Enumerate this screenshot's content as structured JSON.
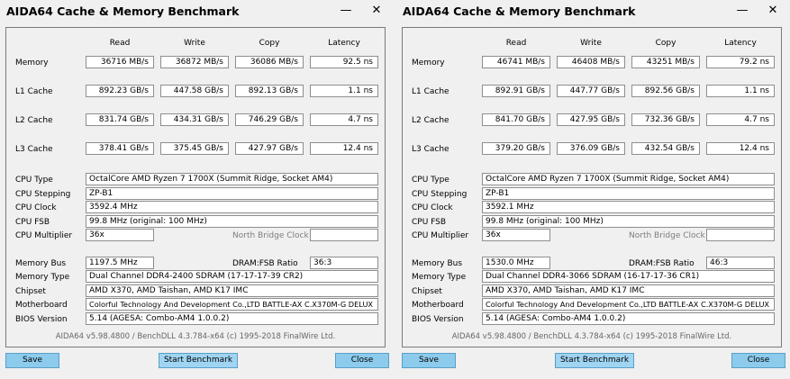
{
  "windows": [
    {
      "title": "AIDA64 Cache & Memory Benchmark",
      "title_buttons": {
        "minimize": "—",
        "close": "✕"
      },
      "headers": [
        "Read",
        "Write",
        "Copy",
        "Latency"
      ],
      "rows": [
        {
          "label": "Memory",
          "values": [
            "36716 MB/s",
            "36872 MB/s",
            "36086 MB/s",
            "92.5 ns"
          ]
        },
        {
          "label": "L1 Cache",
          "values": [
            "892.23 GB/s",
            "447.58 GB/s",
            "892.13 GB/s",
            "1.1 ns"
          ]
        },
        {
          "label": "L2 Cache",
          "values": [
            "831.74 GB/s",
            "434.31 GB/s",
            "746.29 GB/s",
            "4.7 ns"
          ]
        },
        {
          "label": "L3 Cache",
          "values": [
            "378.41 GB/s",
            "375.45 GB/s",
            "427.97 GB/s",
            "12.4 ns"
          ]
        }
      ],
      "cpu": {
        "type_label": "CPU Type",
        "type": "OctalCore AMD Ryzen 7 1700X  (Summit Ridge, Socket AM4)",
        "stepping_label": "CPU Stepping",
        "stepping": "ZP-B1",
        "clock_label": "CPU Clock",
        "clock": "3592.4 MHz",
        "fsb_label": "CPU FSB",
        "fsb": "99.8 MHz  (original: 100 MHz)",
        "multiplier_label": "CPU Multiplier",
        "multiplier": "36x",
        "north_bridge_label": "North Bridge Clock"
      },
      "memory": {
        "bus_label": "Memory Bus",
        "bus": "1197.5 MHz",
        "ratio_label": "DRAM:FSB Ratio",
        "ratio": "36:3",
        "type_label": "Memory Type",
        "type": "Dual Channel DDR4-2400 SDRAM  (17-17-17-39 CR2)",
        "chipset_label": "Chipset",
        "chipset": "AMD X370, AMD Taishan, AMD K17 IMC",
        "motherboard_label": "Motherboard",
        "motherboard": "Colorful Technology And Development Co.,LTD BATTLE-AX C.X370M-G DELUX",
        "bios_label": "BIOS Version",
        "bios": "5.14  (AGESA: Combo-AM4 1.0.0.2)"
      },
      "footer": "AIDA64 v5.98.4800 / BenchDLL 4.3.784-x64  (c) 1995-2018 FinalWire Ltd.",
      "buttons": {
        "save": "Save",
        "start": "Start Benchmark",
        "close": "Close"
      }
    },
    {
      "title": "AIDA64 Cache & Memory Benchmark",
      "title_buttons": {
        "minimize": "—",
        "close": "✕"
      },
      "headers": [
        "Read",
        "Write",
        "Copy",
        "Latency"
      ],
      "rows": [
        {
          "label": "Memory",
          "values": [
            "46741 MB/s",
            "46408 MB/s",
            "43251 MB/s",
            "79.2 ns"
          ]
        },
        {
          "label": "L1 Cache",
          "values": [
            "892.91 GB/s",
            "447.77 GB/s",
            "892.56 GB/s",
            "1.1 ns"
          ]
        },
        {
          "label": "L2 Cache",
          "values": [
            "841.70 GB/s",
            "427.95 GB/s",
            "732.36 GB/s",
            "4.7 ns"
          ]
        },
        {
          "label": "L3 Cache",
          "values": [
            "379.20 GB/s",
            "376.09 GB/s",
            "432.54 GB/s",
            "12.4 ns"
          ]
        }
      ],
      "cpu": {
        "type_label": "CPU Type",
        "type": "OctalCore AMD Ryzen 7 1700X  (Summit Ridge, Socket AM4)",
        "stepping_label": "CPU Stepping",
        "stepping": "ZP-B1",
        "clock_label": "CPU Clock",
        "clock": "3592.1 MHz",
        "fsb_label": "CPU FSB",
        "fsb": "99.8 MHz  (original: 100 MHz)",
        "multiplier_label": "CPU Multiplier",
        "multiplier": "36x",
        "north_bridge_label": "North Bridge Clock"
      },
      "memory": {
        "bus_label": "Memory Bus",
        "bus": "1530.0 MHz",
        "ratio_label": "DRAM:FSB Ratio",
        "ratio": "46:3",
        "type_label": "Memory Type",
        "type": "Dual Channel DDR4-3066 SDRAM  (16-17-17-36 CR1)",
        "chipset_label": "Chipset",
        "chipset": "AMD X370, AMD Taishan, AMD K17 IMC",
        "motherboard_label": "Motherboard",
        "motherboard": "Colorful Technology And Development Co.,LTD BATTLE-AX C.X370M-G DELUX",
        "bios_label": "BIOS Version",
        "bios": "5.14  (AGESA: Combo-AM4 1.0.0.2)"
      },
      "footer": "AIDA64 v5.98.4800 / BenchDLL 4.3.784-x64  (c) 1995-2018 FinalWire Ltd.",
      "buttons": {
        "save": "Save",
        "start": "Start Benchmark",
        "close": "Close"
      }
    }
  ],
  "colors": {
    "button": "#8ccbec",
    "button_border": "#5a9fc8",
    "panel_border": "#7a7a7a"
  }
}
